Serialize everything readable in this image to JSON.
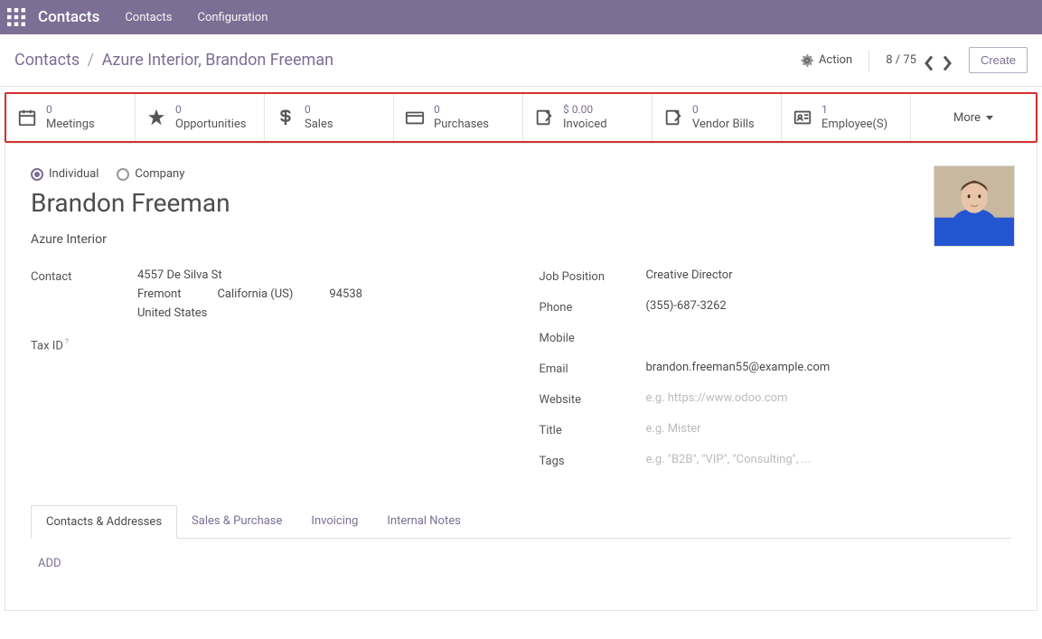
{
  "nav": {
    "app_title": "Contacts",
    "items": [
      "Contacts",
      "Configuration"
    ]
  },
  "breadcrumb": {
    "root": "Contacts",
    "current": "Azure Interior, Brandon Freeman"
  },
  "actions": {
    "action_label": "Action",
    "pager": "8 / 75",
    "create_label": "Create"
  },
  "stats": [
    {
      "value": "0",
      "label": "Meetings",
      "icon": "calendar"
    },
    {
      "value": "0",
      "label": "Opportunities",
      "icon": "star"
    },
    {
      "value": "0",
      "label": "Sales",
      "icon": "dollar"
    },
    {
      "value": "0",
      "label": "Purchases",
      "icon": "card"
    },
    {
      "value": "$ 0.00",
      "label": "Invoiced",
      "icon": "pencil-sq"
    },
    {
      "value": "0",
      "label": "Vendor Bills",
      "icon": "pencil-sq"
    },
    {
      "value": "1",
      "label": "Employee(S)",
      "icon": "badge"
    }
  ],
  "more_label": "More",
  "radios": {
    "individual": "Individual",
    "company": "Company"
  },
  "contact": {
    "name": "Brandon Freeman",
    "company": "Azure Interior",
    "labels": {
      "contact": "Contact",
      "tax_id": "Tax ID",
      "job_position": "Job Position",
      "phone": "Phone",
      "mobile": "Mobile",
      "email": "Email",
      "website": "Website",
      "title": "Title",
      "tags": "Tags"
    },
    "address": {
      "street": "4557 De Silva St",
      "city": "Fremont",
      "state": "California (US)",
      "zip": "94538",
      "country": "United States"
    },
    "job_position": "Creative Director",
    "phone": "(355)-687-3262",
    "mobile": "",
    "email": "brandon.freeman55@example.com",
    "placeholders": {
      "website": "e.g. https://www.odoo.com",
      "title": "e.g. Mister",
      "tags": "e.g. \"B2B\", \"VIP\", \"Consulting\", ..."
    }
  },
  "tabs": {
    "items": [
      "Contacts & Addresses",
      "Sales & Purchase",
      "Invoicing",
      "Internal Notes"
    ],
    "add_label": "ADD"
  }
}
